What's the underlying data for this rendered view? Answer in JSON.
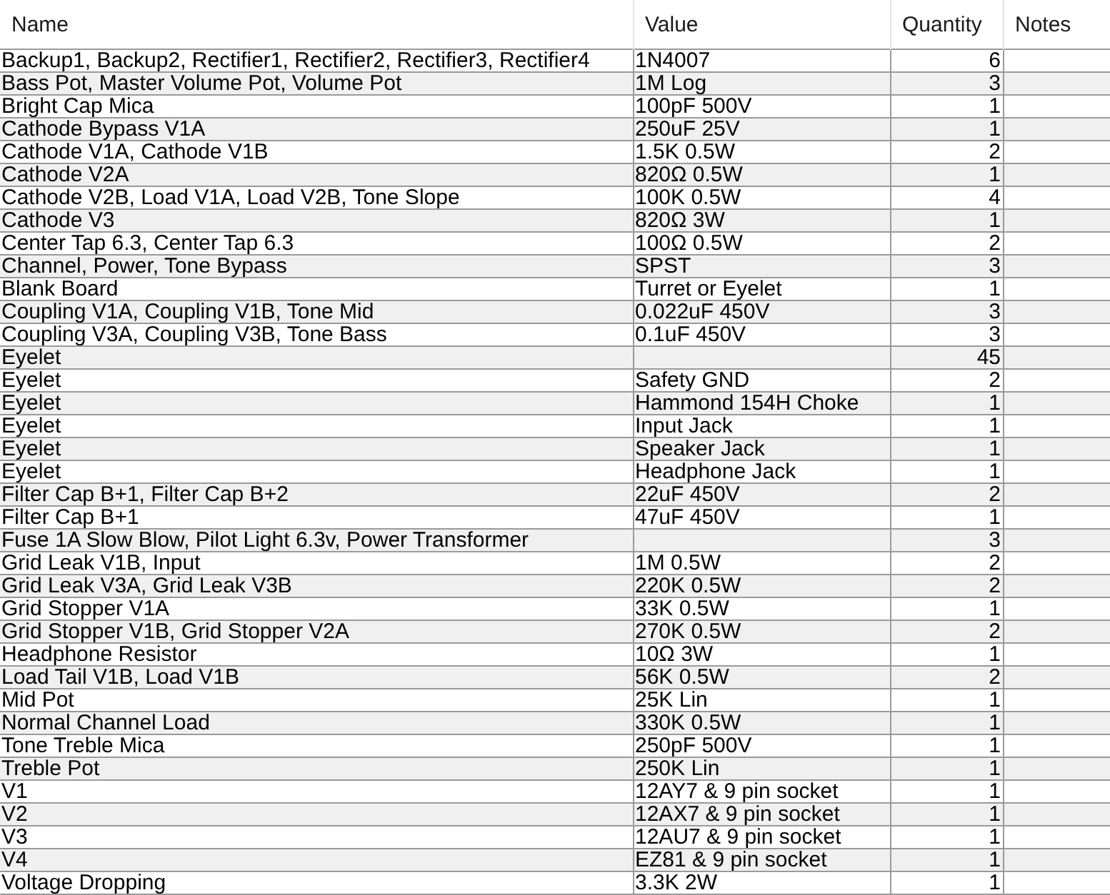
{
  "table": {
    "columns": [
      "Name",
      "Value",
      "Quantity",
      "Notes"
    ],
    "rows": [
      {
        "name": "Backup1, Backup2, Rectifier1, Rectifier2, Rectifier3, Rectifier4",
        "value": "1N4007",
        "quantity": "6"
      },
      {
        "name": "Bass Pot, Master Volume Pot, Volume Pot",
        "value": "1M Log",
        "quantity": "3"
      },
      {
        "name": "Bright Cap Mica",
        "value": "100pF 500V",
        "quantity": "1"
      },
      {
        "name": "Cathode Bypass V1A",
        "value": "250uF 25V",
        "quantity": "1"
      },
      {
        "name": "Cathode V1A, Cathode V1B",
        "value": "1.5K 0.5W",
        "quantity": "2"
      },
      {
        "name": "Cathode V2A",
        "value": "820Ω 0.5W",
        "quantity": "1"
      },
      {
        "name": "Cathode V2B, Load V1A, Load V2B, Tone Slope",
        "value": "100K 0.5W",
        "quantity": "4"
      },
      {
        "name": "Cathode V3",
        "value": "820Ω 3W",
        "quantity": "1"
      },
      {
        "name": "Center Tap 6.3, Center Tap 6.3",
        "value": "100Ω 0.5W",
        "quantity": "2"
      },
      {
        "name": "Channel, Power, Tone Bypass",
        "value": "SPST",
        "quantity": "3"
      },
      {
        "name": "Blank Board",
        "value": "Turret or Eyelet",
        "quantity": "1"
      },
      {
        "name": "Coupling V1A, Coupling V1B, Tone Mid",
        "value": "0.022uF 450V",
        "quantity": "3"
      },
      {
        "name": "Coupling V3A, Coupling V3B, Tone Bass",
        "value": "0.1uF 450V",
        "quantity": "3"
      },
      {
        "name": "Eyelet",
        "quantity": "45"
      },
      {
        "name": "Eyelet",
        "value": "Safety GND",
        "quantity": "2"
      },
      {
        "name": "Eyelet",
        "value": "Hammond 154H Choke",
        "quantity": "1"
      },
      {
        "name": "Eyelet",
        "value": "Input Jack",
        "quantity": "1"
      },
      {
        "name": "Eyelet",
        "value": "Speaker Jack",
        "quantity": "1"
      },
      {
        "name": "Eyelet",
        "value": "Headphone Jack",
        "quantity": "1"
      },
      {
        "name": "Filter Cap B+1, Filter Cap B+2",
        "value": "22uF 450V",
        "quantity": "2"
      },
      {
        "name": "Filter Cap B+1",
        "value": "47uF 450V",
        "quantity": "1"
      },
      {
        "name": "Fuse 1A Slow Blow, Pilot Light 6.3v, Power Transformer",
        "quantity": "3"
      },
      {
        "name": "Grid Leak V1B, Input",
        "value": "1M 0.5W",
        "quantity": "2"
      },
      {
        "name": "Grid Leak V3A, Grid Leak V3B",
        "value": "220K 0.5W",
        "quantity": "2"
      },
      {
        "name": "Grid Stopper V1A",
        "value": "33K 0.5W",
        "quantity": "1"
      },
      {
        "name": "Grid Stopper V1B, Grid Stopper V2A",
        "value": "270K 0.5W",
        "quantity": "2"
      },
      {
        "name": "Headphone Resistor",
        "value": "10Ω 3W",
        "quantity": "1"
      },
      {
        "name": "Load Tail V1B, Load V1B",
        "value": "56K 0.5W",
        "quantity": "2"
      },
      {
        "name": "Mid Pot",
        "value": "25K Lin",
        "quantity": "1"
      },
      {
        "name": "Normal Channel Load",
        "value": "330K 0.5W",
        "quantity": "1"
      },
      {
        "name": "Tone Treble Mica",
        "value": "250pF 500V",
        "quantity": "1"
      },
      {
        "name": "Treble Pot",
        "value": "250K Lin",
        "quantity": "1"
      },
      {
        "name": "V1",
        "value": "12AY7 & 9 pin socket",
        "quantity": "1"
      },
      {
        "name": "V2",
        "value": "12AX7 & 9 pin socket",
        "quantity": "1"
      },
      {
        "name": "V3",
        "value": "12AU7 & 9 pin socket",
        "quantity": "1"
      },
      {
        "name": "V4",
        "value": "EZ81 & 9 pin socket",
        "quantity": "1"
      },
      {
        "name": "Voltage Dropping",
        "value": "3.3K 2W",
        "quantity": "1"
      }
    ]
  }
}
